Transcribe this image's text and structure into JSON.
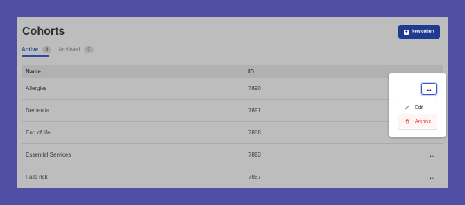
{
  "title": "Cohorts",
  "new_button": {
    "label": "New cohort",
    "icon": "plus-square-icon"
  },
  "tabs": [
    {
      "label": "Active",
      "count": "8"
    },
    {
      "label": "Archived",
      "count": "0"
    }
  ],
  "table": {
    "headers": [
      "Name",
      "ID"
    ],
    "rows": [
      {
        "name": "Allergies",
        "id": "7890"
      },
      {
        "name": "Dementia",
        "id": "7891"
      },
      {
        "name": "End of life",
        "id": "7888"
      },
      {
        "name": "Essential Services",
        "id": "7893"
      },
      {
        "name": "Falls risk",
        "id": "7887"
      }
    ],
    "actions_label": "..."
  },
  "menu": {
    "edit": "Edit",
    "archive": "Archive",
    "edit_icon": "pencil-icon",
    "archive_icon": "trash-icon"
  },
  "colors": {
    "background": "#4f4fa6",
    "primary": "#1f3a8e",
    "active_tab": "#2d4ca1",
    "danger": "#e53935"
  }
}
